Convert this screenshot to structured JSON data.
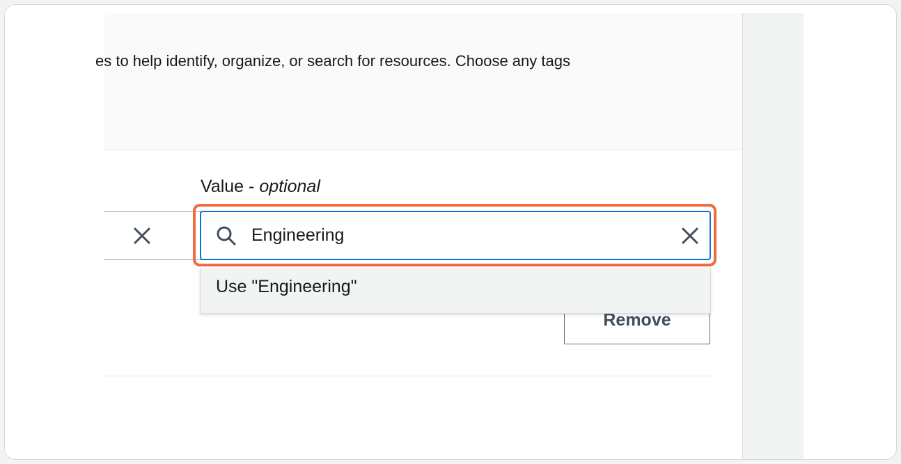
{
  "tags_panel": {
    "description_fragment": "es to help identify, organize, or search for resources. Choose any tags",
    "key_clear_icon": "close-icon",
    "value_label": "Value - ",
    "value_label_optional": "optional",
    "value_input": {
      "value": "Engineering",
      "search_icon": "search-icon",
      "clear_icon": "close-icon"
    },
    "suggestion": "Use \"Engineering\"",
    "remove_button": "Remove"
  },
  "colors": {
    "highlight": "#ef6c43",
    "focus_border": "#0972d3",
    "text": "#16191f"
  }
}
